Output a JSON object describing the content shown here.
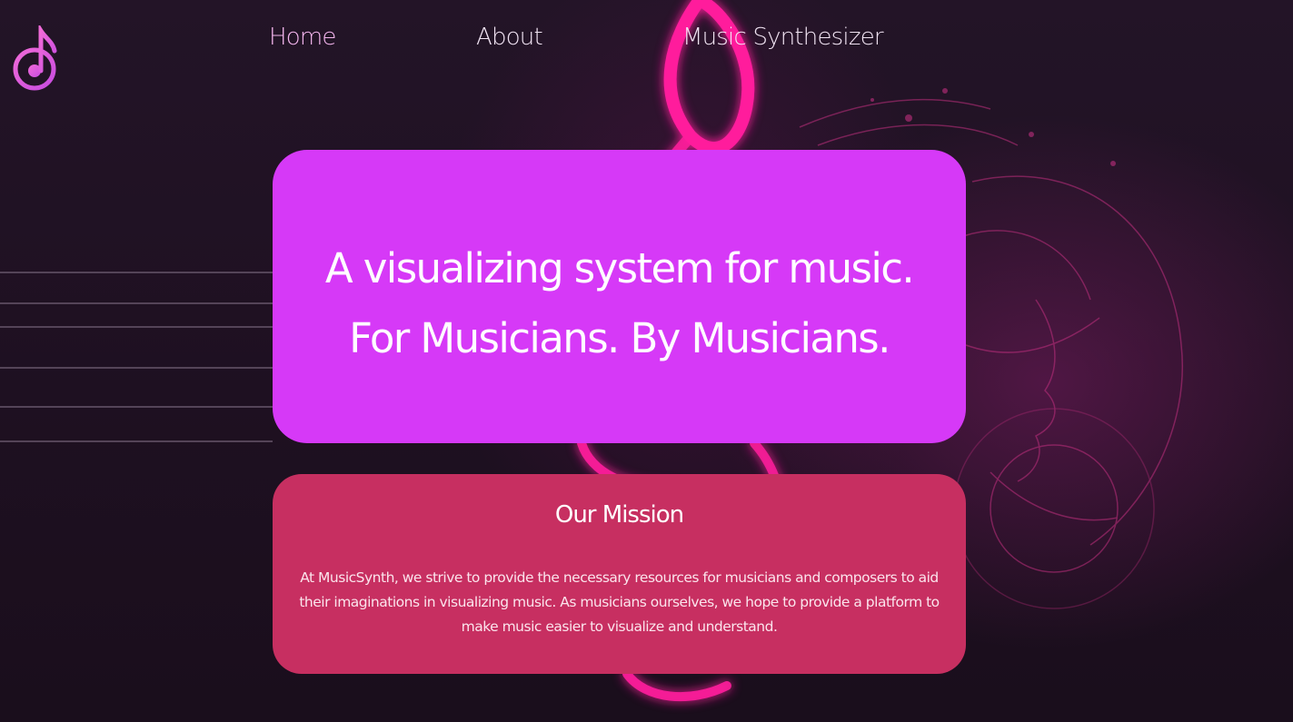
{
  "nav": {
    "logo_icon": "music-note-logo-icon",
    "items": [
      {
        "label": "Home",
        "active": true
      },
      {
        "label": "About",
        "active": false
      },
      {
        "label": "Music Synthesizer",
        "active": false
      }
    ]
  },
  "hero": {
    "line1": "A visualizing system for music.",
    "line2": "For Musicians. By Musicians."
  },
  "mission": {
    "title": "Our Mission",
    "text": "At MusicSynth, we strive to provide the necessary resources for musicians and composers to aid their imaginations in visualizing music. As musicians ourselves, we hope to provide a platform to make music easier to visualize and understand."
  },
  "colors": {
    "background": "#1d1020",
    "hero_card": "#d639f7",
    "mission_card": "#c72f61",
    "accent_pink": "#ff2d9a",
    "nav_active": "#f4b6ee"
  },
  "background_art": {
    "icon": "treble-clef-neon-background"
  }
}
